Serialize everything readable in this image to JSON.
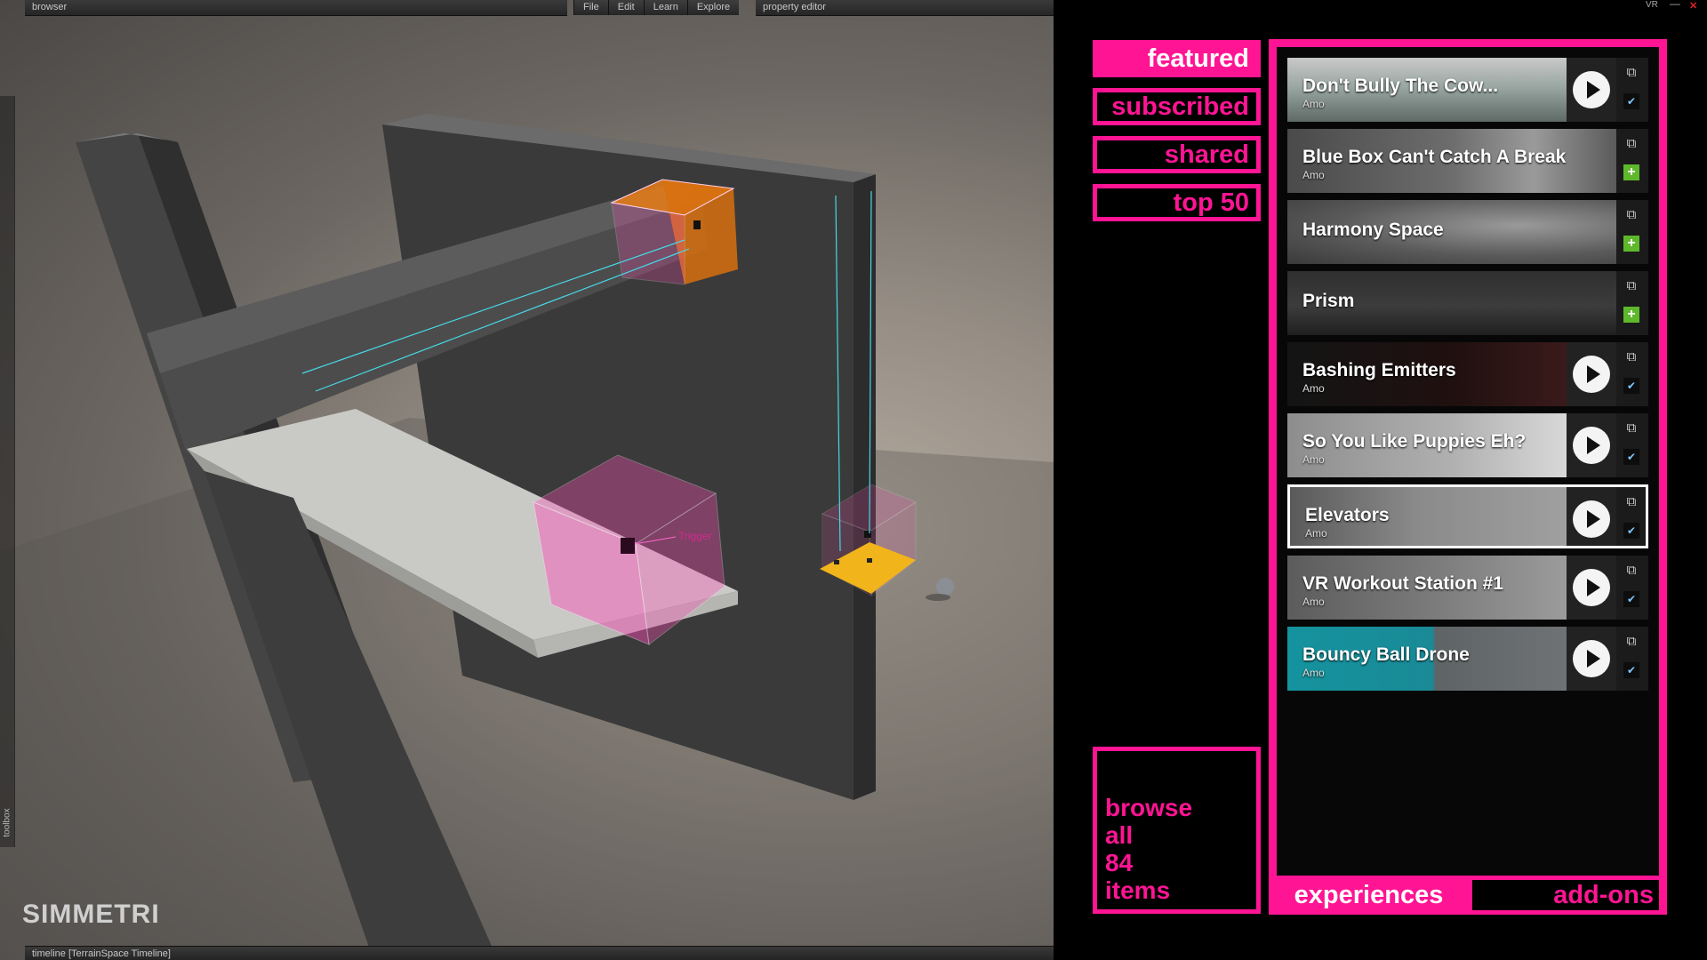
{
  "window": {
    "vr_label": "VR",
    "minimize_glyph": "—",
    "close_glyph": "✕"
  },
  "viewport": {
    "browser_label": "browser",
    "menu": [
      "File",
      "Edit",
      "Learn",
      "Explore"
    ],
    "property_label": "property editor",
    "timeline_label": "timeline [TerrainSpace Timeline]",
    "toolbox_label": "toolbox",
    "logo": "SIMMETRI",
    "trigger_label": "Trigger"
  },
  "nav": {
    "featured": "featured",
    "subscribed": "subscribed",
    "shared": "shared",
    "top50": "top 50",
    "browse_all": [
      "browse",
      "all",
      "84",
      "items"
    ]
  },
  "tabs": {
    "experiences": "experiences",
    "addons": "add-ons"
  },
  "items": [
    {
      "title": "Don't Bully The Cow...",
      "author": "Amo",
      "action": "check"
    },
    {
      "title": "Blue Box Can't Catch A Break",
      "author": "Amo",
      "action": "add"
    },
    {
      "title": "Harmony Space",
      "author": "",
      "action": "add"
    },
    {
      "title": "Prism",
      "author": "",
      "action": "add"
    },
    {
      "title": "Bashing Emitters",
      "author": "Amo",
      "action": "check"
    },
    {
      "title": "So You Like Puppies Eh?",
      "author": "Amo",
      "action": "check"
    },
    {
      "title": "Elevators",
      "author": "Amo",
      "action": "check"
    },
    {
      "title": "VR Workout Station #1",
      "author": "Amo",
      "action": "check"
    },
    {
      "title": "Bouncy Ball Drone",
      "author": "Amo",
      "action": "check"
    }
  ],
  "icons": {
    "external": "external-link-icon",
    "check": "check-icon",
    "add": "plus-icon",
    "play": "play-icon"
  },
  "colors": {
    "accent": "#ff1493",
    "add_green": "#5fb82b",
    "teal_thumb": "#14939e"
  }
}
